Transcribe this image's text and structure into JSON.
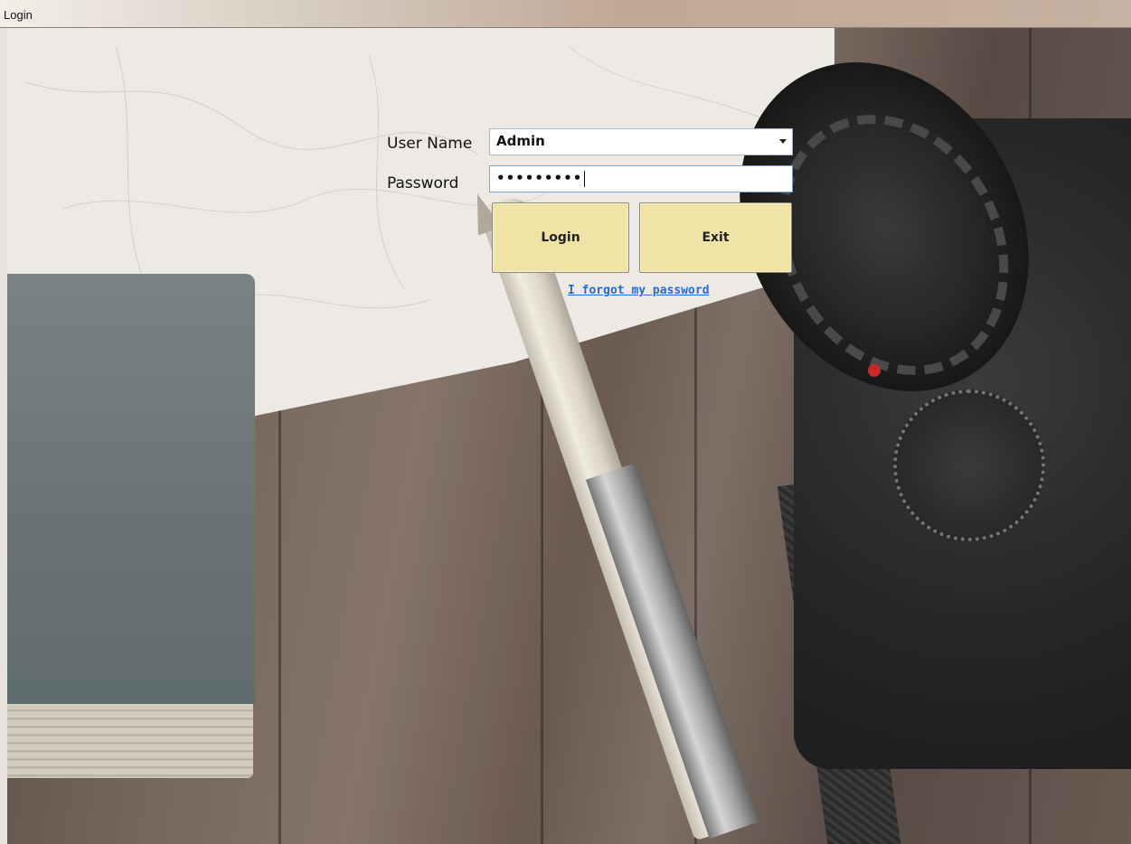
{
  "window": {
    "title": "Login"
  },
  "form": {
    "username_label": "User Name",
    "username_value": "Admin",
    "password_label": "Password",
    "password_masked": "•••••••••",
    "login_button": "Login",
    "exit_button": "Exit",
    "forgot_link": "I forgot my password"
  },
  "colors": {
    "button_bg": "#efe4a6",
    "link": "#1a6fd8"
  },
  "icons": {
    "dropdown": "chevron-down-icon"
  }
}
